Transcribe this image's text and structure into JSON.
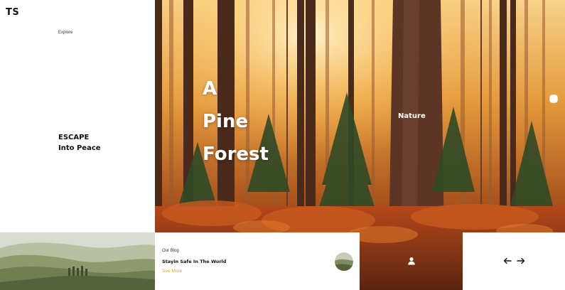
{
  "brand": {
    "logo": "TS"
  },
  "nav": {
    "explore_label": "Explore"
  },
  "tagline": {
    "line1": "ESCAPE",
    "line2": "Into Peace"
  },
  "hero": {
    "title_lines": [
      "A",
      "Pine",
      "Forest"
    ],
    "category": "Nature"
  },
  "social": {
    "icons": [
      "facebook-icon",
      "instagram-icon",
      "twitter-icon"
    ]
  },
  "blog": {
    "label": "Our Blog",
    "title": "Stayin Safe In The World",
    "link_text": "See More"
  },
  "carousel": {
    "icons": [
      "arrow-left-icon",
      "arrow-right-icon"
    ]
  },
  "colors": {
    "accent": "#e0a13a",
    "text_dark": "#111111",
    "background": "#ffffff"
  }
}
